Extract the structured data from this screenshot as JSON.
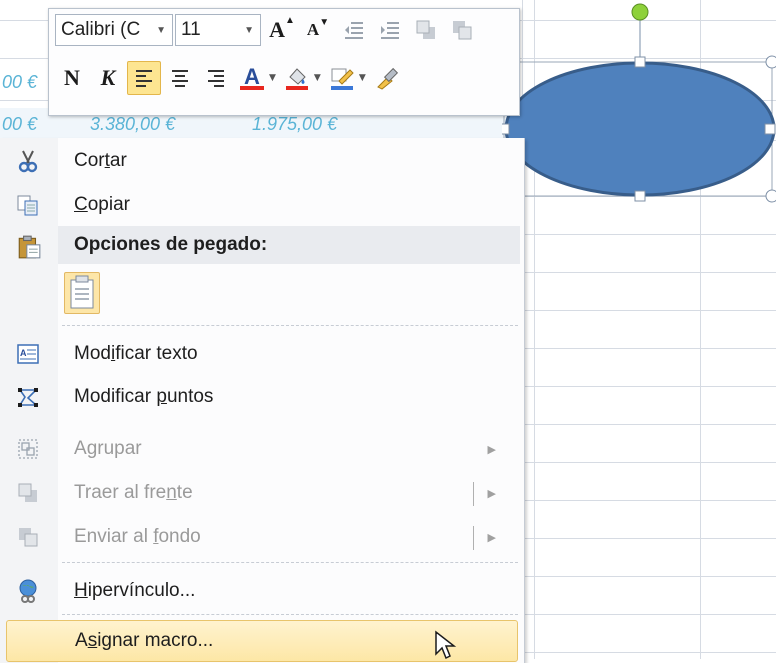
{
  "spreadsheet": {
    "row1": [
      "00 €"
    ],
    "row2": [
      "00 €",
      "3.380,00 €",
      "1.975,00 €"
    ]
  },
  "mini_toolbar": {
    "font_name": "Calibri (C",
    "font_size": "11",
    "grow_font": "A",
    "shrink_font": "A",
    "bold": "N",
    "italic": "K",
    "font_color_letter": "A"
  },
  "context_menu": {
    "items": [
      {
        "label_pre": "Cor",
        "label_u": "t",
        "label_post": "ar",
        "icon": "scissors-icon",
        "enabled": true
      },
      {
        "label_pre": "",
        "label_u": "C",
        "label_post": "opiar",
        "icon": "copy-icon",
        "enabled": true
      },
      {
        "label": "Opciones de pegado:",
        "icon": "paste-icon",
        "header": true
      },
      {
        "label_pre": "Mod",
        "label_u": "i",
        "label_post": "ficar texto",
        "icon": "edit-text-icon",
        "enabled": true
      },
      {
        "label_pre": "Modificar ",
        "label_u": "p",
        "label_post": "untos",
        "icon": "edit-points-icon",
        "enabled": true
      },
      {
        "label_pre": "A",
        "label_u": "g",
        "label_post": "rupar",
        "icon": "group-icon",
        "enabled": false
      },
      {
        "label_pre": "Traer al fre",
        "label_u": "n",
        "label_post": "te",
        "icon": "bring-front-icon",
        "enabled": false
      },
      {
        "label_pre": "Enviar al ",
        "label_u": "f",
        "label_post": "ondo",
        "icon": "send-back-icon",
        "enabled": false
      },
      {
        "label_pre": "",
        "label_u": "H",
        "label_post": "ipervínculo...",
        "icon": "hyperlink-icon",
        "enabled": true
      },
      {
        "label_pre": "A",
        "label_u": "s",
        "label_post": "ignar macro...",
        "icon": "",
        "enabled": true
      }
    ]
  },
  "colors": {
    "shape_fill": "#4f81bd",
    "shape_border": "#385d8a",
    "highlight": "#fde591",
    "cell_text": "#5ab4d6"
  }
}
